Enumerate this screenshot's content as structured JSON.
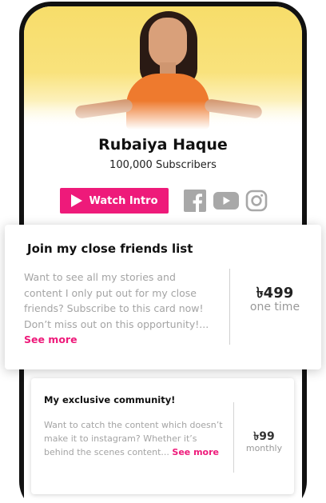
{
  "profile": {
    "name": "Rubaiya Haque",
    "subscribers": "100,000 Subscribers",
    "watch_label": "Watch Intro"
  },
  "socials": [
    "facebook-icon",
    "youtube-icon",
    "instagram-icon"
  ],
  "colors": {
    "accent": "#ee1a7a",
    "hero_yellow": "#f7dd6a",
    "muted_text": "#a4a4a4",
    "social_grey": "#a8a8a8"
  },
  "cards": [
    {
      "title": "Join my close friends list",
      "description": "Want to see all my stories and content I only put out for my close friends? Subscribe to this card now! Don’t miss out on this opportunity!...",
      "see_more": "See more",
      "price": "৳499",
      "period": "one time"
    },
    {
      "title": "My exclusive community!",
      "description": "Want to catch the content which doesn’t make it to instagram? Whether it’s behind the scenes content...",
      "see_more": "See more",
      "price": "৳99",
      "period": "monthly"
    }
  ]
}
